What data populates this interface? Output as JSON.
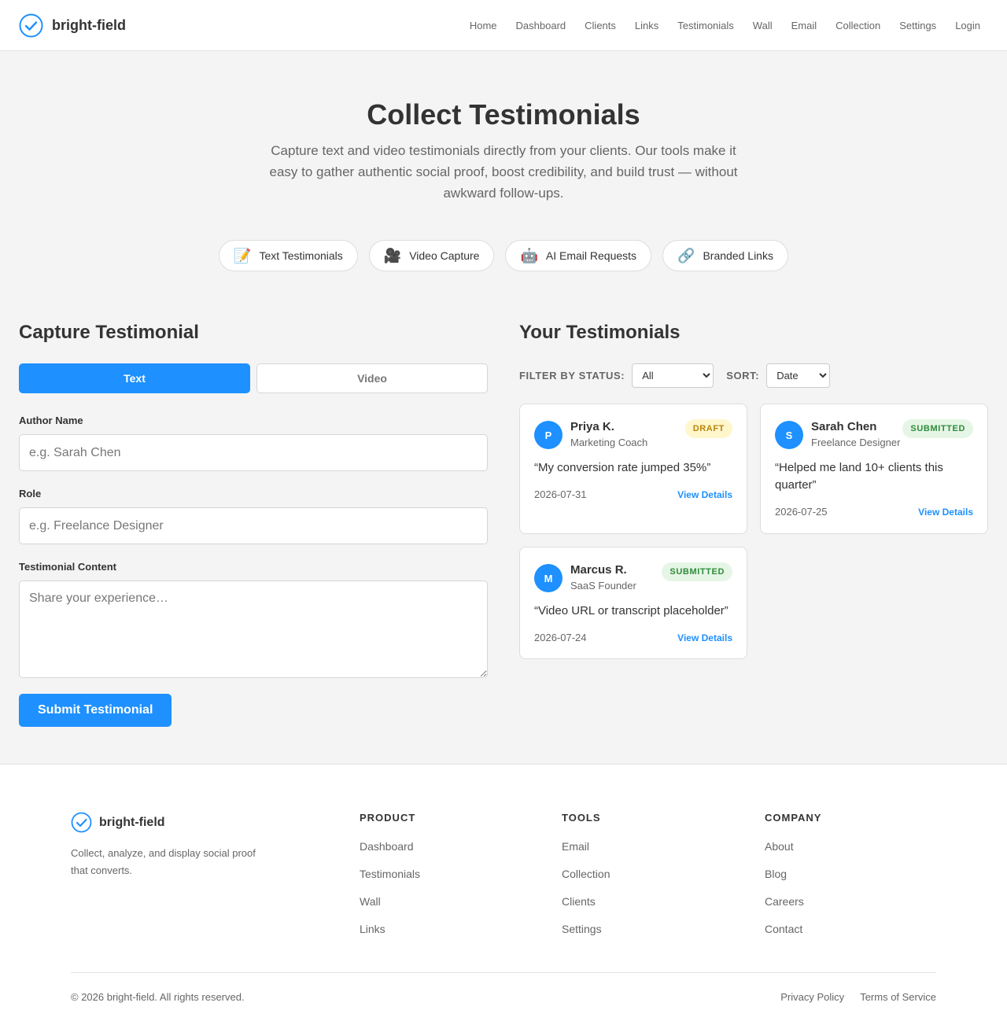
{
  "header": {
    "brand": "bright-field",
    "nav": [
      "Home",
      "Dashboard",
      "Clients",
      "Links",
      "Testimonials",
      "Wall",
      "Email",
      "Collection",
      "Settings",
      "Login"
    ]
  },
  "hero": {
    "title": "Collect Testimonials",
    "description": "Capture text and video testimonials directly from your clients. Our tools make it easy to gather authentic social proof, boost credibility, and build trust — without awkward follow-ups.",
    "features": [
      {
        "emoji": "📝",
        "label": "Text Testimonials"
      },
      {
        "emoji": "🎥",
        "label": "Video Capture"
      },
      {
        "emoji": "🤖",
        "label": "AI Email Requests"
      },
      {
        "emoji": "🔗",
        "label": "Branded Links"
      }
    ]
  },
  "capture": {
    "title": "Capture Testimonial",
    "tabs": [
      "Text",
      "Video"
    ],
    "active_tab": "Text",
    "author_label": "Author Name",
    "author_placeholder": "e.g. Sarah Chen",
    "author_value": "",
    "role_label": "Role",
    "role_placeholder": "e.g. Freelance Designer",
    "role_value": "",
    "content_label": "Testimonial Content",
    "content_placeholder": "Share your experience…",
    "content_value": "",
    "submit_label": "Submit Testimonial"
  },
  "list": {
    "title": "Your Testimonials",
    "filter_label": "FILTER BY STATUS:",
    "filter_value": "All",
    "sort_label": "SORT:",
    "sort_value": "Date",
    "view_details_label": "View Details",
    "cards": [
      {
        "initial": "P",
        "name": "Priya K.",
        "role": "Marketing Coach",
        "status": "DRAFT",
        "quote": "“My conversion rate jumped 35%”",
        "date": "2026-07-31"
      },
      {
        "initial": "S",
        "name": "Sarah Chen",
        "role": "Freelance Designer",
        "status": "SUBMITTED",
        "quote": "“Helped me land 10+ clients this quarter”",
        "date": "2026-07-25"
      },
      {
        "initial": "M",
        "name": "Marcus R.",
        "role": "SaaS Founder",
        "status": "SUBMITTED",
        "quote": "“Video URL or transcript placeholder”",
        "date": "2026-07-24"
      }
    ]
  },
  "footer": {
    "brand": "bright-field",
    "tagline": "Collect, analyze, and display social proof that converts.",
    "columns": [
      {
        "heading": "PRODUCT",
        "links": [
          "Dashboard",
          "Testimonials",
          "Wall",
          "Links"
        ]
      },
      {
        "heading": "TOOLS",
        "links": [
          "Email",
          "Collection",
          "Clients",
          "Settings"
        ]
      },
      {
        "heading": "COMPANY",
        "links": [
          "About",
          "Blog",
          "Careers",
          "Contact"
        ]
      }
    ],
    "copyright": "© 2026 bright-field. All rights reserved.",
    "legal_links": [
      "Privacy Policy",
      "Terms of Service"
    ]
  },
  "colors": {
    "accent": "#1e90ff",
    "draft_bg": "#fff6cc",
    "draft_text": "#b8860b",
    "submitted_bg": "#e6f6e6",
    "submitted_text": "#2e8b3a"
  },
  "icons": {
    "brand": "check-circle-icon"
  }
}
